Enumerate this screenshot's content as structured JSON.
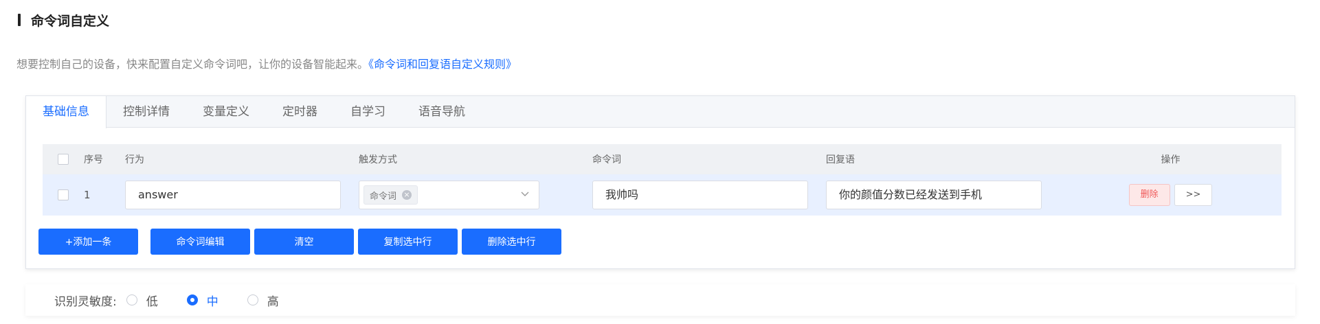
{
  "section": {
    "title": "命令词自定义"
  },
  "description": {
    "text": "想要控制自己的设备，快来配置自定义命令词吧，让你的设备智能起来。",
    "link": "《命令词和回复语自定义规则》"
  },
  "tabs": [
    {
      "label": "基础信息",
      "active": true
    },
    {
      "label": "控制详情",
      "active": false
    },
    {
      "label": "变量定义",
      "active": false
    },
    {
      "label": "定时器",
      "active": false
    },
    {
      "label": "自学习",
      "active": false
    },
    {
      "label": "语音导航",
      "active": false
    }
  ],
  "table": {
    "headers": {
      "index": "序号",
      "action": "行为",
      "trigger": "触发方式",
      "command": "命令词",
      "reply": "回复语",
      "operation": "操作"
    },
    "rows": [
      {
        "index": "1",
        "action": "answer",
        "trigger_tag": "命令词",
        "command": "我帅吗",
        "reply": "你的颜值分数已经发送到手机",
        "delete_label": "删除",
        "more_label": ">>"
      }
    ]
  },
  "actions": {
    "add": "+添加一条",
    "edit": "命令词编辑",
    "clear": "清空",
    "copy": "复制选中行",
    "delete": "删除选中行"
  },
  "sensitivity": {
    "label": "识别灵敏度:",
    "options": [
      "低",
      "中",
      "高"
    ],
    "selected": "中"
  },
  "colors": {
    "primary": "#1a6dff",
    "danger": "#f05a5a",
    "row_highlight": "#e8f0ff"
  }
}
